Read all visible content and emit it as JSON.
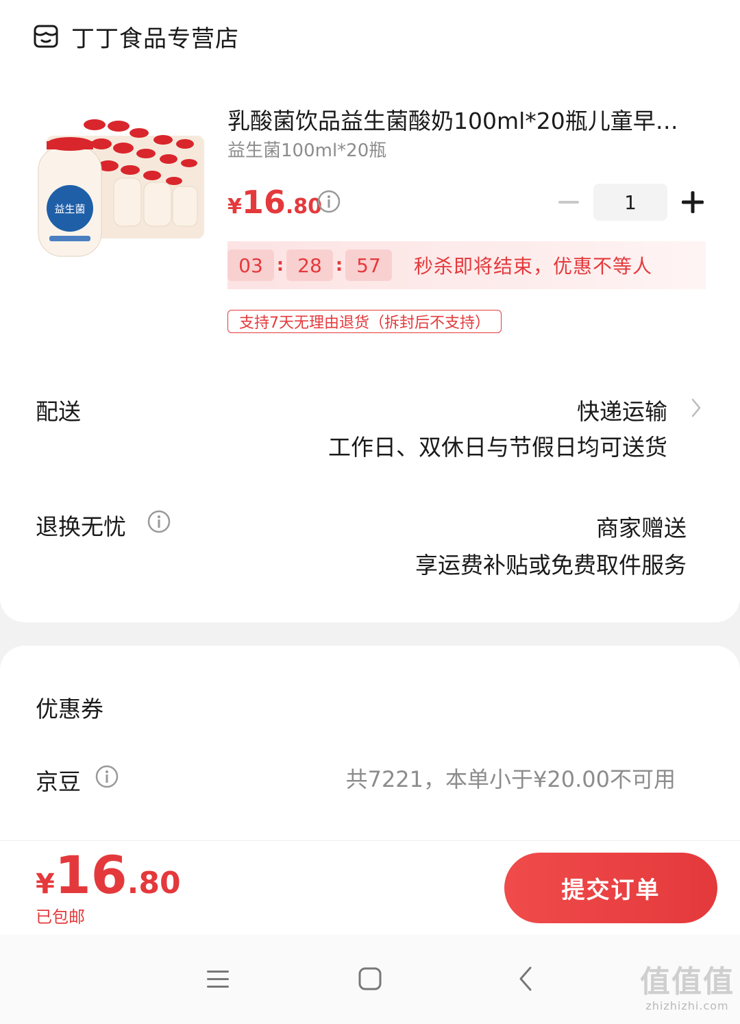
{
  "shop": {
    "icon": "shop-icon",
    "name": "丁丁食品专营店"
  },
  "product": {
    "title": "乳酸菌饮品益生菌酸奶100ml*20瓶儿童早餐奶饮料",
    "spec": "益生菌100ml*20瓶",
    "price_symbol": "¥",
    "price_int": "16",
    "price_dec": ".80",
    "quantity": "1"
  },
  "flash_sale": {
    "hours": "03",
    "minutes": "28",
    "seconds": "57",
    "separator": ":",
    "text": "秒杀即将结束，优惠不等人"
  },
  "return_badge": "支持7天无理由退货（拆封后不支持）",
  "delivery": {
    "label": "配送",
    "method": "快递运输",
    "detail": "工作日、双休日与节假日均可送货"
  },
  "return_service": {
    "label": "退换无忧",
    "value": "商家赠送",
    "detail": "享运费补贴或免费取件服务"
  },
  "coupon": {
    "label": "优惠券"
  },
  "jingdou": {
    "label": "京豆",
    "note": "共7221，本单小于¥20.00不可用"
  },
  "footer": {
    "total_symbol": "¥",
    "total_int": "16",
    "total_dec": ".80",
    "shipping": "已包邮",
    "submit_label": "提交订单"
  },
  "watermark": {
    "big": "值值值",
    "small": "zhizhizhi.com"
  },
  "colors": {
    "accent": "#e4393c",
    "muted": "#8c8c8c"
  }
}
